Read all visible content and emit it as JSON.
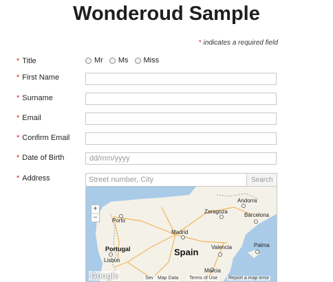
{
  "page": {
    "title": "Wonderoud Sample"
  },
  "required_note": {
    "star": "*",
    "text": " indicates a required field"
  },
  "form": {
    "title_label": "Title",
    "title_options": [
      "Mr",
      "Ms",
      "Miss"
    ],
    "first_name_label": "First Name",
    "surname_label": "Surname",
    "email_label": "Email",
    "confirm_email_label": "Confirm Email",
    "dob_label": "Date of Birth",
    "dob_placeholder": "dd/mm/yyyy",
    "address_label": "Address",
    "address_placeholder": "Street number, City",
    "search_label": "Search"
  },
  "map": {
    "zoom_in": "+",
    "zoom_out": "−",
    "cities": [
      "Andorra",
      "Zaragoza",
      "Barcelona",
      "Porto",
      "Madrid",
      "Portugal",
      "Valencia",
      "Palma",
      "Lisbon",
      "Spain",
      "Murcia",
      "Sev"
    ],
    "footer": {
      "brand": "Google",
      "map_data": "Map Data",
      "terms": "Terms of Use",
      "report": "Report a map error"
    }
  },
  "colors": {
    "required": "#d9241b",
    "border": "#c8c8c8",
    "land": "#f4f1e8",
    "sea": "#a9cbe8"
  }
}
